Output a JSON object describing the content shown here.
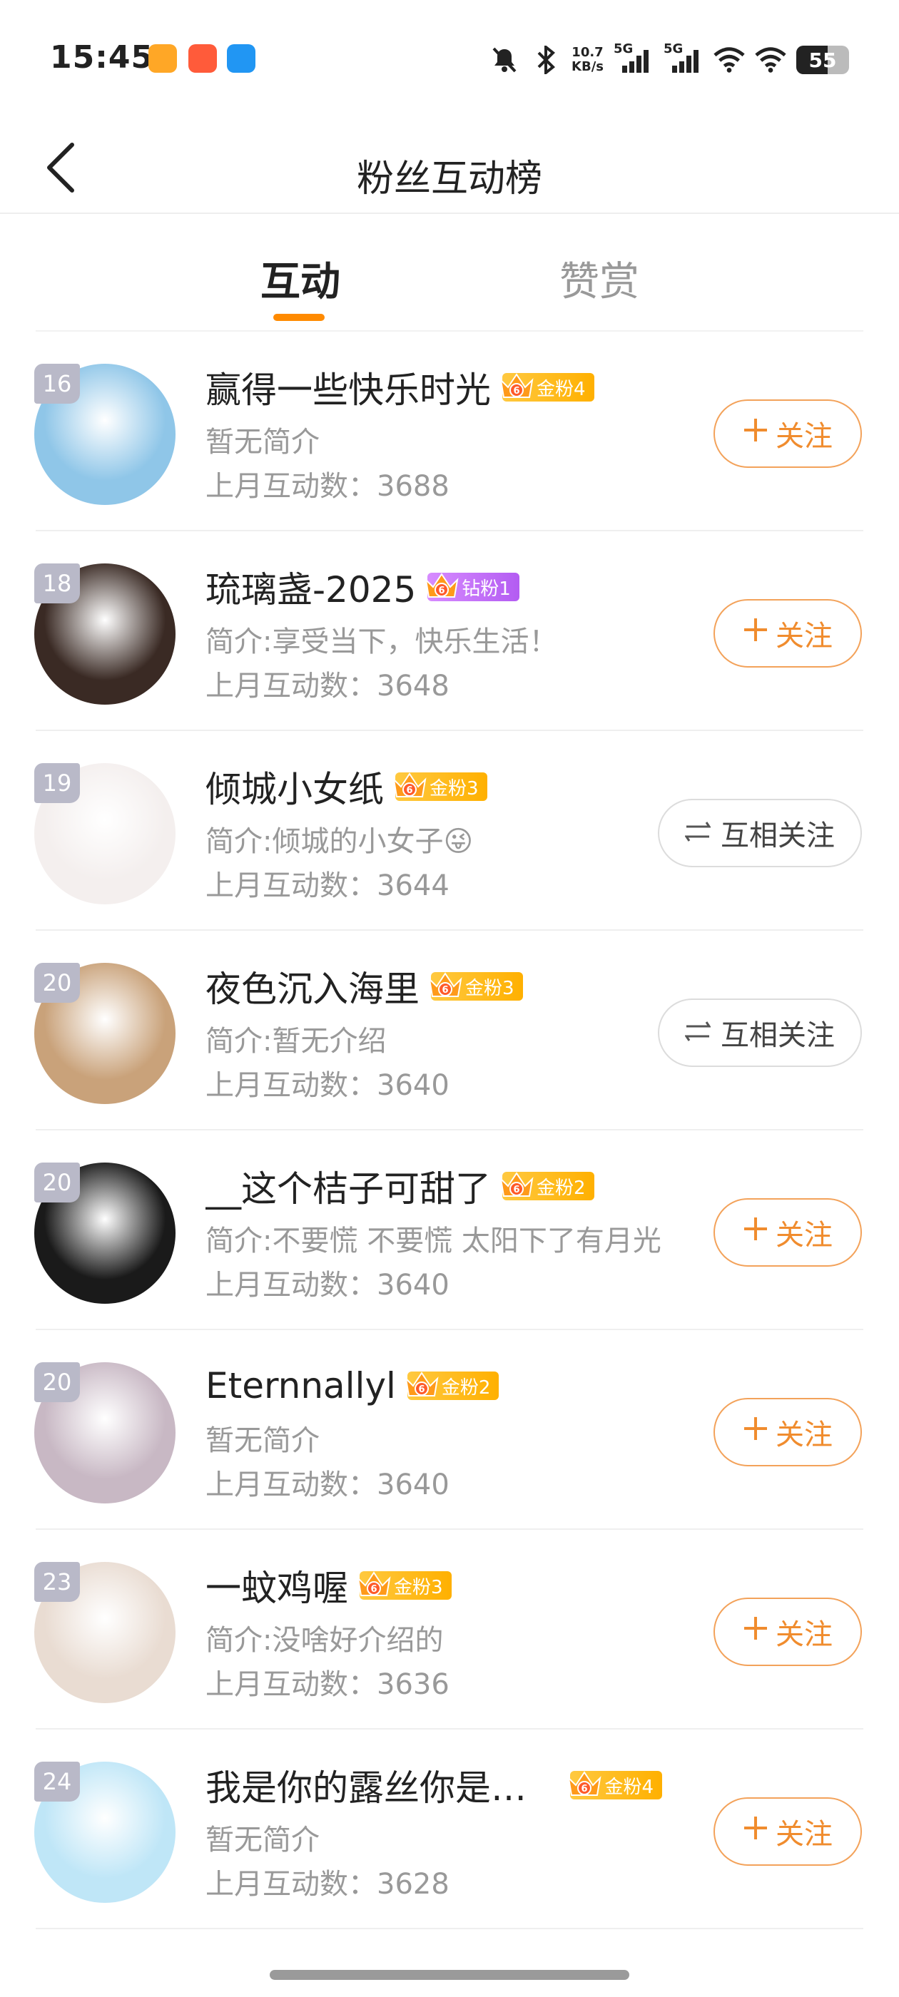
{
  "status_bar": {
    "time": "15:45",
    "net_speed_value": "10.7",
    "net_speed_unit": "KB/s",
    "sim1": "5G",
    "sim2": "5G",
    "battery": "55"
  },
  "header": {
    "title": "粉丝互动榜"
  },
  "tabs": [
    {
      "label": "互动",
      "active": true
    },
    {
      "label": "赞赏",
      "active": false
    }
  ],
  "rows": [
    {
      "rank": "16",
      "name": "赢得一些快乐时光",
      "badge": "金粉4",
      "badge_type": "gold",
      "bio": "暂无简介",
      "count": "上月互动数：3688",
      "action": "+关注",
      "action_type": "follow"
    },
    {
      "rank": "18",
      "name": "琉璃盏-2025",
      "badge": "钻粉1",
      "badge_type": "diamond",
      "bio": "简介:享受当下，快乐生活！",
      "count": "上月互动数：3648",
      "action": "+关注",
      "action_type": "follow"
    },
    {
      "rank": "19",
      "name": "倾城小女纸",
      "badge": "金粉3",
      "badge_type": "gold",
      "bio": "简介:倾城的小女子😜",
      "count": "上月互动数：3644",
      "action": "互相关注",
      "action_type": "mutual"
    },
    {
      "rank": "20",
      "name": "夜色沉入海里",
      "badge": "金粉3",
      "badge_type": "gold",
      "bio": "简介:暂无介绍",
      "count": "上月互动数：3640",
      "action": "互相关注",
      "action_type": "mutual"
    },
    {
      "rank": "20",
      "name": "__这个桔子可甜了",
      "badge": "金粉2",
      "badge_type": "gold",
      "bio": "简介:不要慌 不要慌 太阳下了有月光",
      "count": "上月互动数：3640",
      "action": "+关注",
      "action_type": "follow"
    },
    {
      "rank": "20",
      "name": "Eternnallyl",
      "badge": "金粉2",
      "badge_type": "gold",
      "bio": "暂无简介",
      "count": "上月互动数：3640",
      "action": "+关注",
      "action_type": "follow"
    },
    {
      "rank": "23",
      "name": "一蚊鸡喔",
      "badge": "金粉3",
      "badge_type": "gold",
      "bio": "简介:没啥好介绍的",
      "count": "上月互动数：3636",
      "action": "+关注",
      "action_type": "follow"
    },
    {
      "rank": "24",
      "name": "我是你的露丝你是我…",
      "badge": "金粉4",
      "badge_type": "gold",
      "bio": "暂无简介",
      "count": "上月互动数：3628",
      "action": "+关注",
      "action_type": "follow"
    }
  ],
  "avatar_colors": [
    "#8fc6e8",
    "#3a2a24",
    "#f4efee",
    "#c9a27a",
    "#1a1a1a",
    "#c8b8c4",
    "#e9dcd2",
    "#bfe6f7"
  ]
}
